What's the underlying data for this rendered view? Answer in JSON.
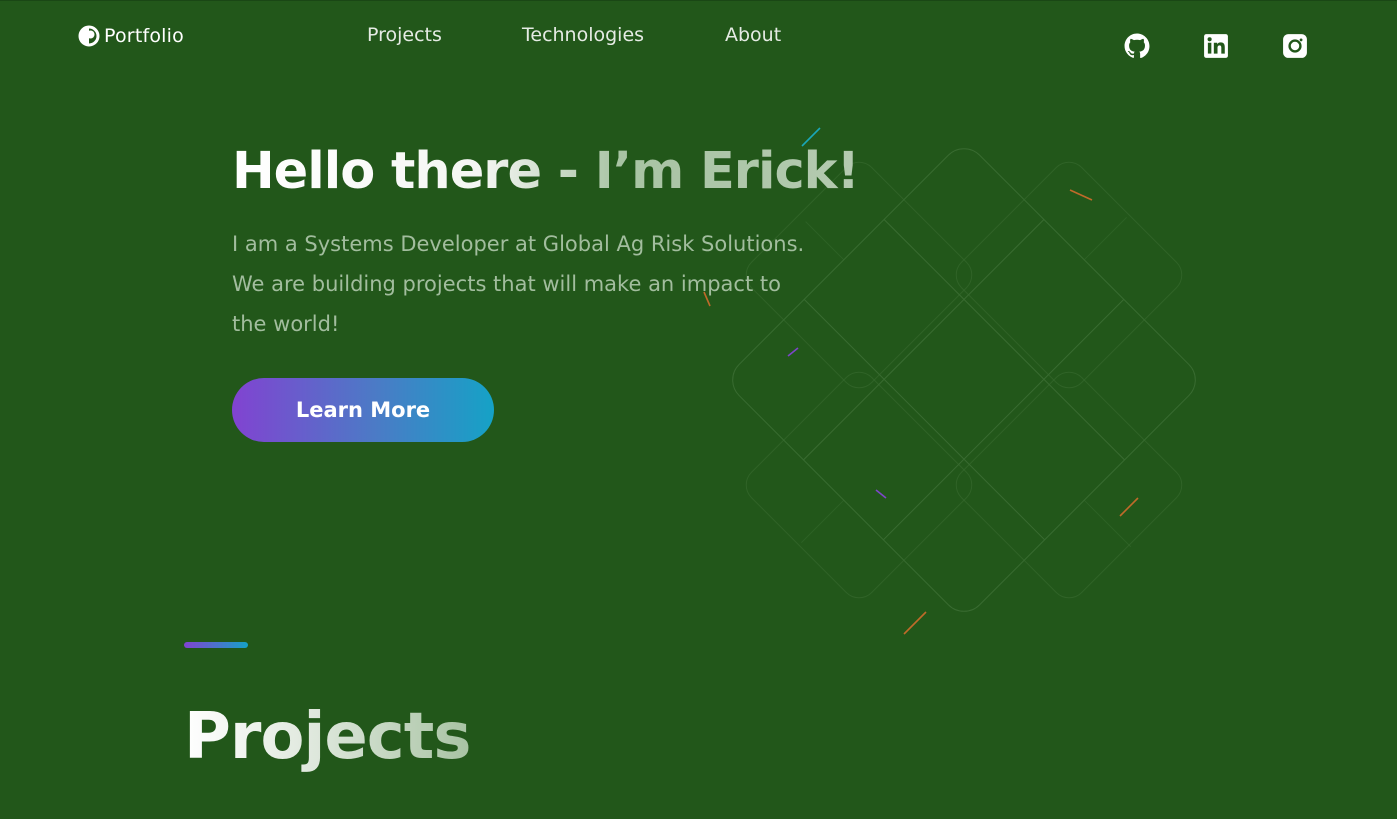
{
  "header": {
    "logo_text": "Portfolio",
    "nav": {
      "projects": "Projects",
      "technologies": "Technologies",
      "about": "About"
    },
    "social": [
      "github-icon",
      "linkedin-icon",
      "instagram-icon"
    ]
  },
  "hero": {
    "title": "Hello there - I’m Erick!",
    "description": "I am a Systems Developer at Global Ag Risk Solutions. We are building projects that will make an impact to the world!",
    "button_label": "Learn More"
  },
  "projects_section": {
    "title": "Projects"
  },
  "colors": {
    "background": "#22571a",
    "gradient_start": "#8143d1",
    "gradient_end": "#15a2c6",
    "muted_text": "#a2bd9e"
  }
}
